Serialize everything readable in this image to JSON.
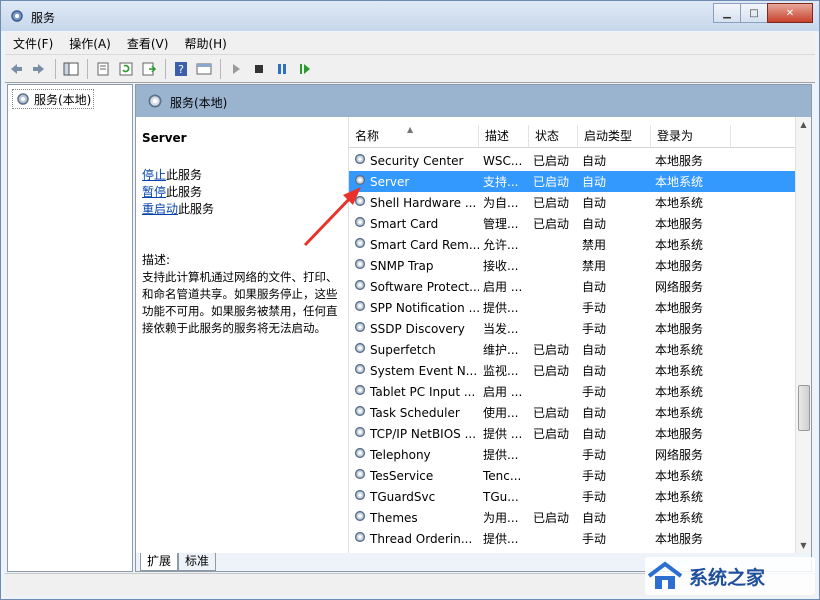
{
  "window": {
    "title": "服务"
  },
  "menu": [
    "文件(F)",
    "操作(A)",
    "查看(V)",
    "帮助(H)"
  ],
  "tree": {
    "root": "服务(本地)"
  },
  "pane": {
    "header": "服务(本地)"
  },
  "detail": {
    "service_name": "Server",
    "actions": [
      {
        "link": "停止",
        "suffix": "此服务"
      },
      {
        "link": "暂停",
        "suffix": "此服务"
      },
      {
        "link": "重启动",
        "suffix": "此服务"
      }
    ],
    "desc_label": "描述:",
    "desc_text": "支持此计算机通过网络的文件、打印、和命名管道共享。如果服务停止，这些功能不可用。如果服务被禁用，任何直接依赖于此服务的服务将无法启动。"
  },
  "columns": [
    "名称",
    "描述",
    "状态",
    "启动类型",
    "登录为"
  ],
  "services": [
    {
      "name": "Security Center",
      "desc": "WSC...",
      "status": "已启动",
      "startup": "自动",
      "logon": "本地服务",
      "selected": false
    },
    {
      "name": "Server",
      "desc": "支持...",
      "status": "已启动",
      "startup": "自动",
      "logon": "本地系统",
      "selected": true
    },
    {
      "name": "Shell Hardware ...",
      "desc": "为自...",
      "status": "已启动",
      "startup": "自动",
      "logon": "本地系统",
      "selected": false
    },
    {
      "name": "Smart Card",
      "desc": "管理...",
      "status": "已启动",
      "startup": "自动",
      "logon": "本地服务",
      "selected": false
    },
    {
      "name": "Smart Card Rem...",
      "desc": "允许...",
      "status": "",
      "startup": "禁用",
      "logon": "本地系统",
      "selected": false
    },
    {
      "name": "SNMP Trap",
      "desc": "接收...",
      "status": "",
      "startup": "禁用",
      "logon": "本地服务",
      "selected": false
    },
    {
      "name": "Software Protect...",
      "desc": "启用 ...",
      "status": "",
      "startup": "自动",
      "logon": "网络服务",
      "selected": false
    },
    {
      "name": "SPP Notification ...",
      "desc": "提供...",
      "status": "",
      "startup": "手动",
      "logon": "本地服务",
      "selected": false
    },
    {
      "name": "SSDP Discovery",
      "desc": "当发...",
      "status": "",
      "startup": "手动",
      "logon": "本地服务",
      "selected": false
    },
    {
      "name": "Superfetch",
      "desc": "维护...",
      "status": "已启动",
      "startup": "自动",
      "logon": "本地系统",
      "selected": false
    },
    {
      "name": "System Event N...",
      "desc": "监视...",
      "status": "已启动",
      "startup": "自动",
      "logon": "本地系统",
      "selected": false
    },
    {
      "name": "Tablet PC Input ...",
      "desc": "启用 ...",
      "status": "",
      "startup": "手动",
      "logon": "本地系统",
      "selected": false
    },
    {
      "name": "Task Scheduler",
      "desc": "使用...",
      "status": "已启动",
      "startup": "自动",
      "logon": "本地系统",
      "selected": false
    },
    {
      "name": "TCP/IP NetBIOS ...",
      "desc": "提供 ...",
      "status": "已启动",
      "startup": "自动",
      "logon": "本地服务",
      "selected": false
    },
    {
      "name": "Telephony",
      "desc": "提供...",
      "status": "",
      "startup": "手动",
      "logon": "网络服务",
      "selected": false
    },
    {
      "name": "TesService",
      "desc": "Tenc...",
      "status": "",
      "startup": "手动",
      "logon": "本地系统",
      "selected": false
    },
    {
      "name": "TGuardSvc",
      "desc": "TGu...",
      "status": "",
      "startup": "手动",
      "logon": "本地系统",
      "selected": false
    },
    {
      "name": "Themes",
      "desc": "为用...",
      "status": "已启动",
      "startup": "自动",
      "logon": "本地系统",
      "selected": false
    },
    {
      "name": "Thread Orderin...",
      "desc": "提供...",
      "status": "",
      "startup": "手动",
      "logon": "本地服务",
      "selected": false
    }
  ],
  "tabs": [
    "扩展",
    "标准"
  ],
  "watermark": {
    "text": "系统之家"
  },
  "colors": {
    "selection": "#3399ff",
    "pane_header": "#9ab4d0",
    "arrow": "#e8322b"
  }
}
